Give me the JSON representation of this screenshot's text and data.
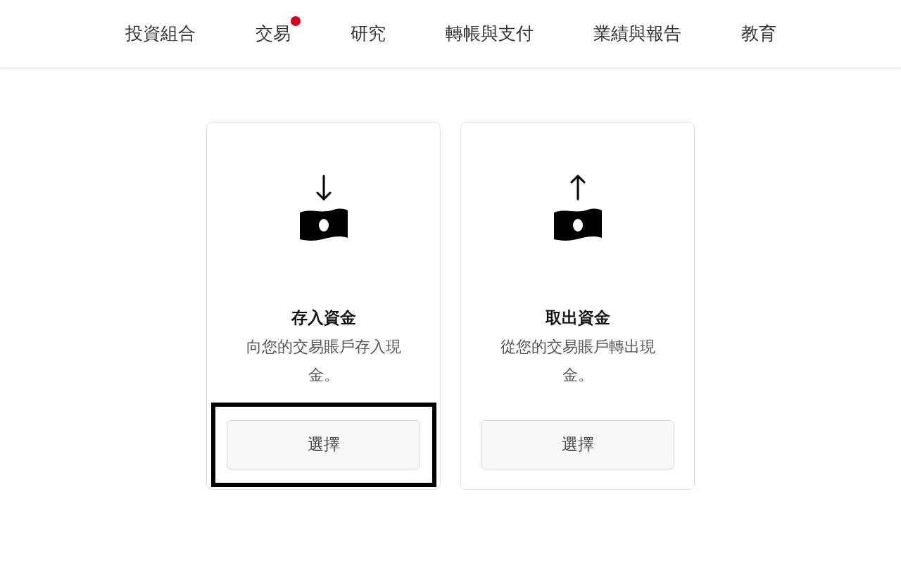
{
  "nav": {
    "items": [
      {
        "label": "投資組合",
        "badge": false
      },
      {
        "label": "交易",
        "badge": true
      },
      {
        "label": "研究",
        "badge": false
      },
      {
        "label": "轉帳與支付",
        "badge": false
      },
      {
        "label": "業績與報告",
        "badge": false
      },
      {
        "label": "教育",
        "badge": false
      }
    ]
  },
  "cards": [
    {
      "kind": "deposit",
      "title": "存入資金",
      "description": "向您的交易賬戶存入現金。",
      "button": "選擇",
      "highlighted": true
    },
    {
      "kind": "withdraw",
      "title": "取出資金",
      "description": "從您的交易賬戶轉出現金。",
      "button": "選擇",
      "highlighted": false
    }
  ]
}
